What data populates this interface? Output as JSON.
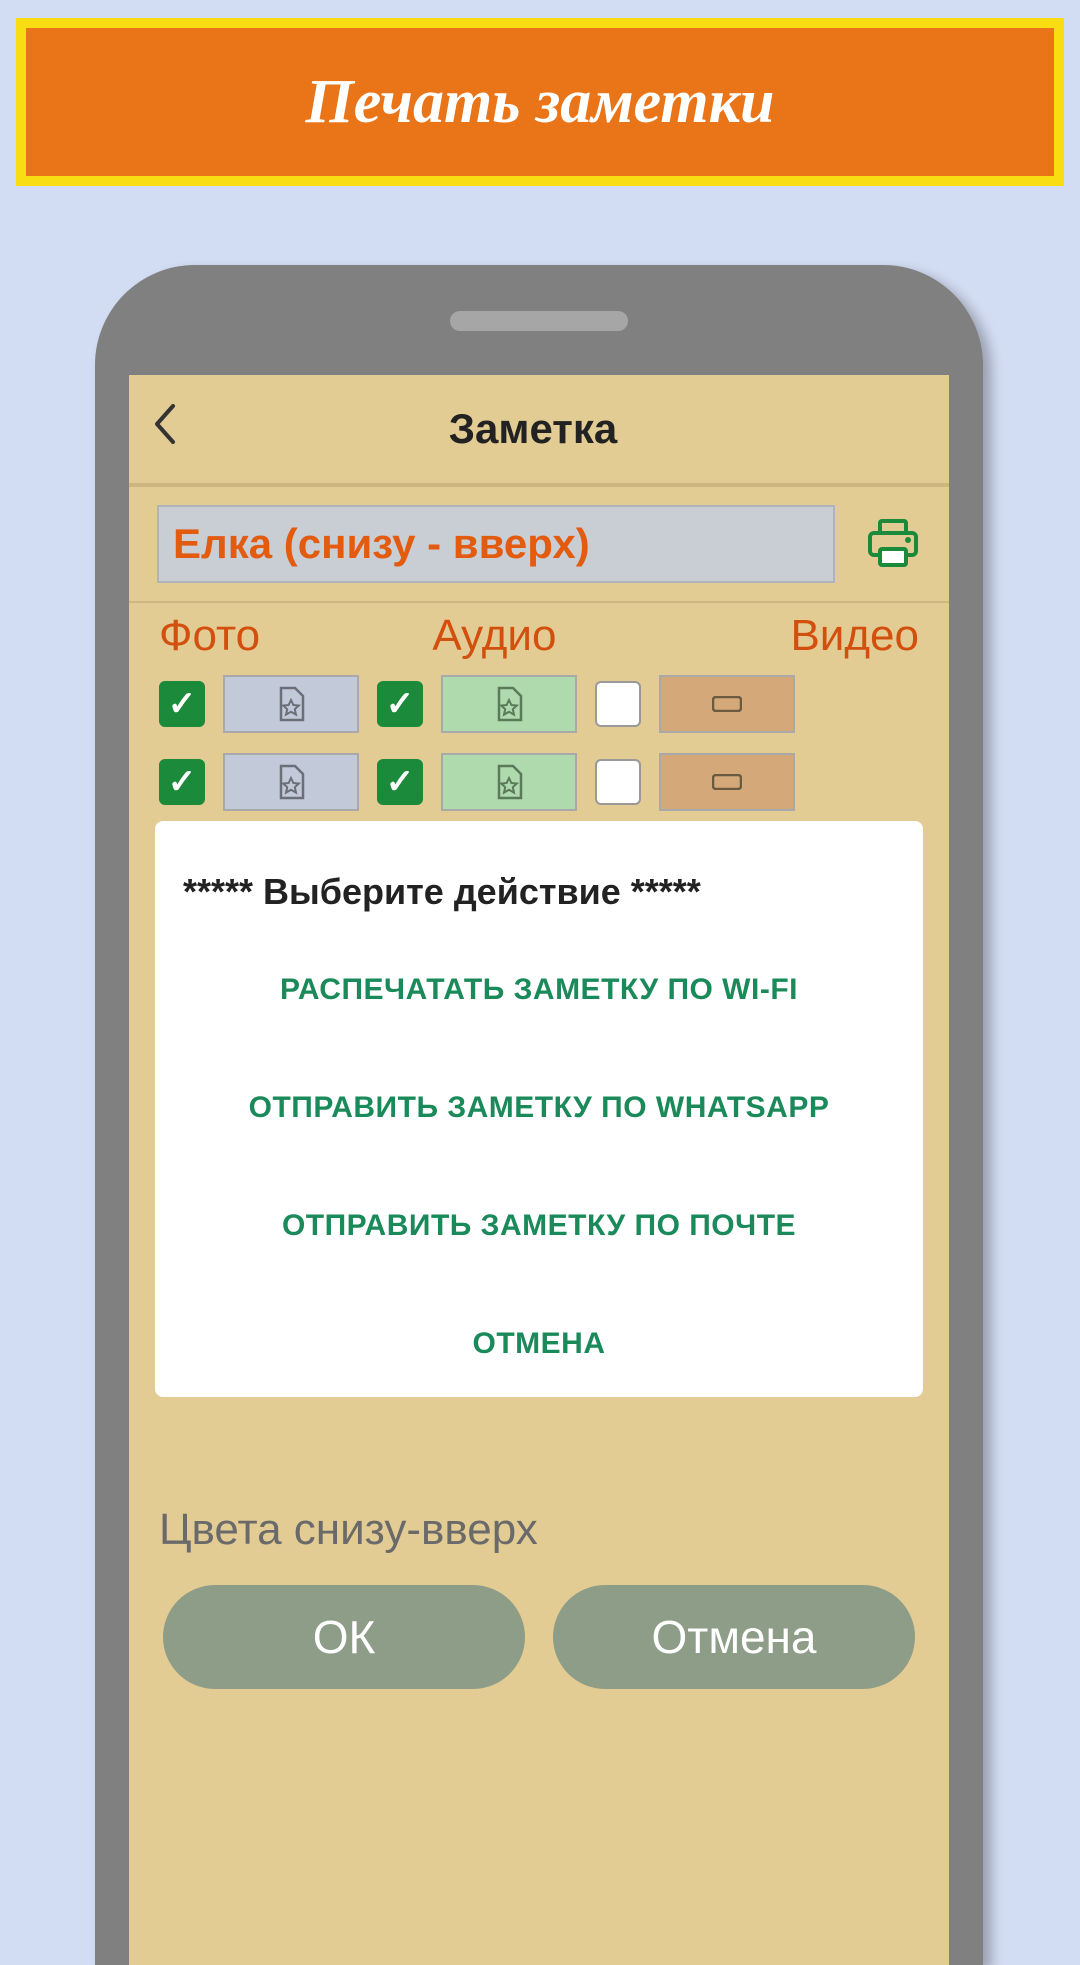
{
  "banner": {
    "title": "Печать заметки"
  },
  "topbar": {
    "title": "Заметка"
  },
  "note": {
    "title": "Елка (снизу - вверх)"
  },
  "tabs": {
    "photo": "Фото",
    "audio": "Аудио",
    "video": "Видео"
  },
  "rows": [
    {
      "photo": true,
      "audio": true,
      "video": false
    },
    {
      "photo": true,
      "audio": true,
      "video": false
    }
  ],
  "body_text": "Цвета снизу-вверх",
  "dialog": {
    "title": "***** Выберите действие *****",
    "opt_wifi": "РАСПЕЧАТАТЬ ЗАМЕТКУ ПО WI-FI",
    "opt_whatsapp": "ОТПРАВИТЬ ЗАМЕТКУ ПО WHATSAPP",
    "opt_mail": "ОТПРАВИТЬ ЗАМЕТКУ ПО ПОЧТЕ",
    "opt_cancel": "ОТМЕНА"
  },
  "buttons": {
    "ok": "ОК",
    "cancel": "Отмена"
  }
}
